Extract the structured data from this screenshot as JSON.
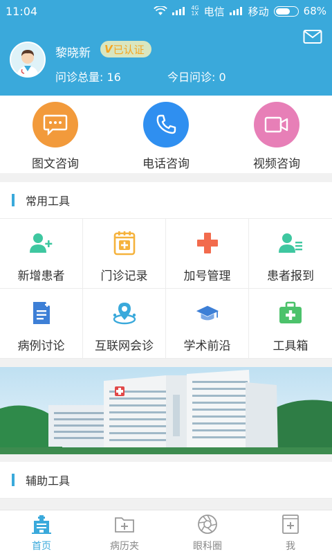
{
  "status": {
    "time": "11:04",
    "net_small_top": "4G",
    "net_small_bottom": "1X",
    "carrier1": "电信",
    "carrier2": "移动",
    "battery": "68%"
  },
  "profile": {
    "name": "黎晓新",
    "badge": "已认证",
    "badge_mark": "V",
    "total_label": "问诊总量: 16",
    "today_label": "今日问诊: 0"
  },
  "consult": [
    {
      "label": "图文咨询",
      "color": "#f29a3b",
      "icon": "chat-bubble-icon"
    },
    {
      "label": "电话咨询",
      "color": "#2f8ff0",
      "icon": "phone-icon"
    },
    {
      "label": "视频咨询",
      "color": "#e77fb7",
      "icon": "video-camera-icon"
    }
  ],
  "common_tools": {
    "title": "常用工具",
    "items": [
      {
        "label": "新增患者",
        "icon": "add-user-icon"
      },
      {
        "label": "门诊记录",
        "icon": "clinic-record-icon"
      },
      {
        "label": "加号管理",
        "icon": "plus-icon"
      },
      {
        "label": "患者报到",
        "icon": "patient-checkin-icon"
      },
      {
        "label": "病例讨论",
        "icon": "document-icon"
      },
      {
        "label": "互联网会诊",
        "icon": "location-network-icon"
      },
      {
        "label": "学术前沿",
        "icon": "graduation-cap-icon"
      },
      {
        "label": "工具箱",
        "icon": "first-aid-kit-icon"
      }
    ]
  },
  "aux_tools": {
    "title": "辅助工具"
  },
  "tabs": [
    {
      "label": "首页",
      "icon": "home-hospital-icon",
      "active": true
    },
    {
      "label": "病历夹",
      "icon": "folder-plus-icon",
      "active": false
    },
    {
      "label": "眼科圈",
      "icon": "aperture-icon",
      "active": false
    },
    {
      "label": "我",
      "icon": "profile-card-icon",
      "active": false
    }
  ],
  "colors": {
    "primary": "#3aa9db",
    "tool_green": "#3ec7a0",
    "tool_orange": "#f5b23c",
    "tool_red": "#f26b4d",
    "tool_blue": "#3d7fd6"
  }
}
